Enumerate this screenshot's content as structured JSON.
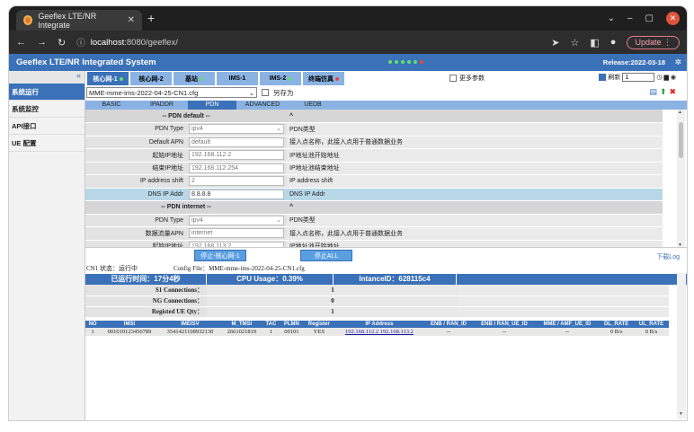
{
  "browser": {
    "tab_title": "Geeflex LTE/NR Integrate",
    "url_host": "localhost",
    "url_rest": ":8080/geeflex/",
    "update_label": "Update"
  },
  "app": {
    "title": "Geeflex LTE/NR Integrated System",
    "release": "Release:2022-03-18"
  },
  "sidebar": {
    "collapse": "«",
    "items": [
      {
        "label": "系统运行",
        "active": true
      },
      {
        "label": "系统监控"
      },
      {
        "label": "API接口"
      },
      {
        "label": "UE 配置"
      }
    ]
  },
  "tabs": [
    {
      "label": "核心网-1",
      "dot": "green",
      "active": true
    },
    {
      "label": "核心网-2",
      "dot": ""
    },
    {
      "label": "基站",
      "dot": "green"
    },
    {
      "label": "IMS-1",
      "dot": ""
    },
    {
      "label": "IMS-2",
      "dot": "green"
    },
    {
      "label": "终端仿真",
      "dot": "red"
    }
  ],
  "more_params": "更多参数",
  "refresh": {
    "label": "刷新",
    "value": "1"
  },
  "config": {
    "file": "MME-mme-ims-2022-04-25-CN1.cfg",
    "save_as": "另存为"
  },
  "subtabs": [
    "BASIC",
    "IPADDR",
    "PDN",
    "ADVANCED",
    "UEDB"
  ],
  "pdn_rows": [
    {
      "type": "header",
      "label": "-- PDN default --",
      "desc": "^"
    },
    {
      "label": "PDN Type",
      "value": "ipv4",
      "select": true,
      "desc": "PDN类型"
    },
    {
      "label": "Default APN",
      "value": "default",
      "desc": "接入点名称，此接入点用于普通数据业务"
    },
    {
      "label": "起始IP地址",
      "value": "192.168.112.2",
      "desc": "IP地址池开始地址"
    },
    {
      "label": "结束IP地址",
      "value": "192.168.112.254",
      "desc": "IP地址池结束地址"
    },
    {
      "label": "IP address shift",
      "value": "2",
      "desc": "IP address shift"
    },
    {
      "label": "DNS IP Addr",
      "value": "8.8.8.8",
      "desc": "DNS IP Addr",
      "selected": true
    },
    {
      "type": "header",
      "label": "-- PDN internet --",
      "desc": "^"
    },
    {
      "label": "PDN Type",
      "value": "ipv4",
      "select": true,
      "desc": "PDN类型"
    },
    {
      "label": "数据流量APN",
      "value": "internet",
      "desc": "接入点名称，此接入点用于普通数据业务"
    },
    {
      "label": "起始IP地址",
      "value": "192.168.113.2",
      "desc": "IP地址池开始地址"
    }
  ],
  "buttons": {
    "stop_core": "停止-核心网-1",
    "stop_all": "停止ALL",
    "download": "下载Log"
  },
  "status": {
    "text": "CN1 状态：运行中",
    "config_file": "Config File：MME-mme-ims-2022-04-25-CN1.cfg"
  },
  "bar": {
    "runtime": "已运行时间：17分4秒",
    "cpu": "CPU Usage：0.39%",
    "instance": "IntanceID：628115c4"
  },
  "stats": [
    {
      "key": "S1 Connections：",
      "value": "1"
    },
    {
      "key": "NG Connections：",
      "value": "0"
    },
    {
      "key": "Registed UE Qty：",
      "value": "1"
    }
  ],
  "ue_table": {
    "headers": [
      "NO",
      "IMSI",
      "IMEISV",
      "M_TMSI",
      "TAC",
      "PLMN",
      "Register",
      "IP Address",
      "ENB / RAN_ID",
      "ENB / RAN_UE_ID",
      "MME / AMF_UE_ID",
      "DL_RATE",
      "UL_RATE"
    ],
    "rows": [
      [
        "1",
        "001010123456789",
        "3541421108932130",
        "2661021819",
        "1",
        "00101",
        "YES",
        "192.168.112.2  192.168.113.2",
        "--",
        "--",
        "--",
        "0  B/s",
        "0  B/s"
      ]
    ]
  }
}
